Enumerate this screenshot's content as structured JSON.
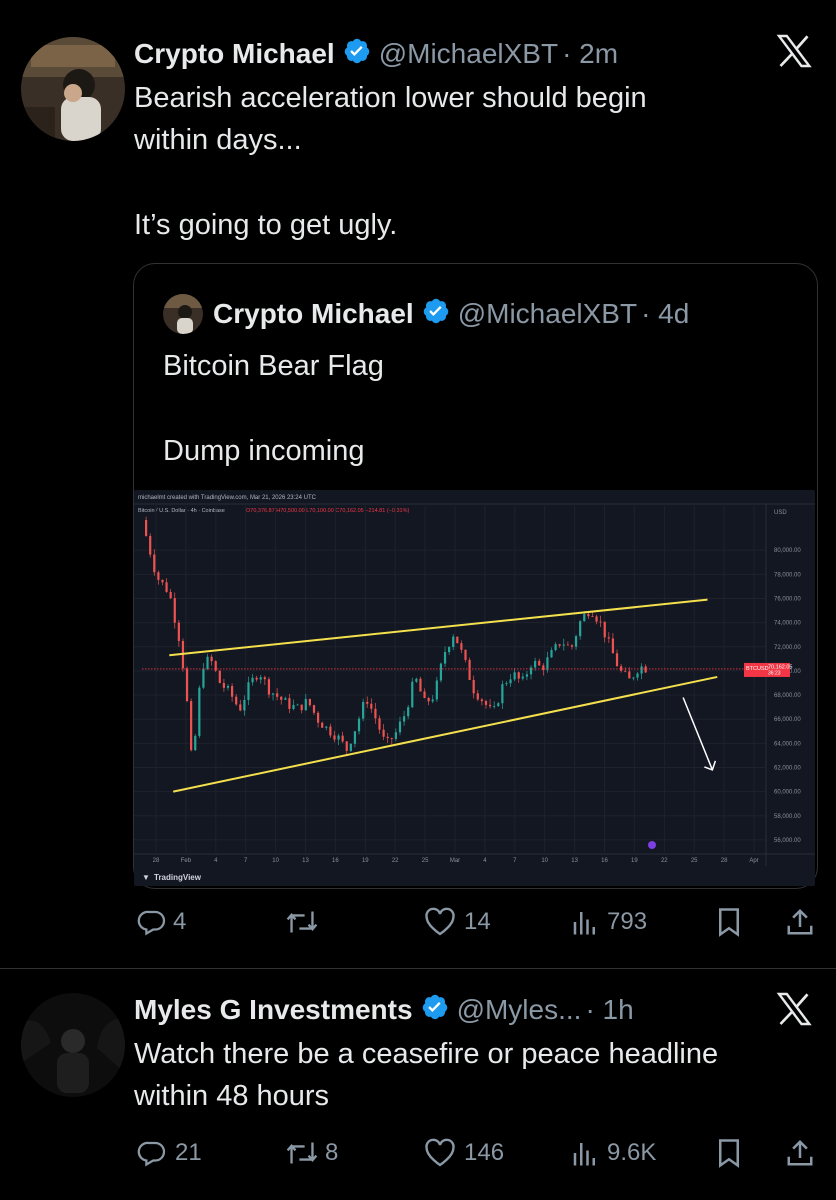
{
  "colors": {
    "background": "#000000",
    "text": "#e7e9ea",
    "muted": "#8b98a5",
    "verified": "#1d9bf0",
    "border": "#2f3336",
    "chart_bg": "#131722",
    "trendline": "#f4e04d",
    "price_line": "#f23645"
  },
  "tweets": [
    {
      "author": "Crypto Michael",
      "handle": "@MichaelXBT",
      "time": "· 2m",
      "text_line1": "Bearish acceleration lower should begin",
      "text_line2": "within days...",
      "text_line3": "It’s going to get ugly.",
      "quote": {
        "author": "Crypto Michael",
        "handle": "@MichaelXBT",
        "time": "· 4d",
        "text_line1": "Bitcoin Bear Flag",
        "text_line2": "Dump incoming",
        "chart": {
          "created_line": "michaelmt created with TradingView.com, Mar 21, 2026 23:24 UTC",
          "symbol_line": "Bitcoin / U.S. Dollar · 4h · Coinbase",
          "ohlc": "O70,376.87 H70,500.00 L70,100.00 C70,162.05 −214.81 (−0.31%)",
          "currency": "USD",
          "price_tag_symbol": "BTCUSD",
          "price_tag_value": "70,162.05",
          "price_tag_sub": "36:23",
          "watermark": "TradingView"
        }
      },
      "actions": {
        "replies": "4",
        "reposts": "",
        "likes": "14",
        "views": "793"
      }
    },
    {
      "author": "Myles G Investments",
      "handle": "@Myles...",
      "time": "· 1h",
      "text_line1": "Watch there be a ceasefire or peace headline",
      "text_line2": "within 48 hours",
      "actions": {
        "replies": "21",
        "reposts": "8",
        "likes": "146",
        "views": "9.6K"
      }
    }
  ],
  "icons": [
    "x-logo-icon",
    "verified-badge-icon",
    "reply-icon",
    "repost-icon",
    "like-icon",
    "views-icon",
    "bookmark-icon",
    "share-icon"
  ],
  "chart_data": {
    "type": "candlestick",
    "title": "Bitcoin / U.S. Dollar · 4h · Coinbase",
    "y_ticks": [
      "80,000.00",
      "78,000.00",
      "76,000.00",
      "74,000.00",
      "72,000.00",
      "70,000.00",
      "68,000.00",
      "66,000.00",
      "64,000.00",
      "62,000.00",
      "60,000.00",
      "58,000.00",
      "56,000.00"
    ],
    "x_ticks": [
      "28",
      "Feb",
      "4",
      "7",
      "10",
      "13",
      "16",
      "19",
      "22",
      "25",
      "Mar",
      "4",
      "7",
      "10",
      "13",
      "16",
      "19",
      "22",
      "25",
      "28",
      "Apr"
    ],
    "ylim": [
      55000,
      82500
    ],
    "last_price": 70162.05,
    "price_path": [
      [
        0,
        82500
      ],
      [
        1.5,
        77800
      ],
      [
        2.8,
        76500
      ],
      [
        4,
        72000
      ],
      [
        4.8,
        66000
      ],
      [
        5.2,
        61000
      ],
      [
        5.6,
        66500
      ],
      [
        6.2,
        70500
      ],
      [
        7,
        71000
      ],
      [
        8,
        69000
      ],
      [
        9,
        68200
      ],
      [
        10,
        66800
      ],
      [
        11,
        68800
      ],
      [
        12,
        70000
      ],
      [
        13,
        68500
      ],
      [
        14,
        67800
      ],
      [
        15,
        67200
      ],
      [
        16,
        66900
      ],
      [
        17,
        67500
      ],
      [
        18,
        66000
      ],
      [
        19,
        65200
      ],
      [
        20,
        64600
      ],
      [
        21,
        63500
      ],
      [
        22,
        65500
      ],
      [
        23,
        67800
      ],
      [
        24,
        66000
      ],
      [
        25,
        63800
      ],
      [
        26,
        64800
      ],
      [
        27,
        66500
      ],
      [
        28,
        69500
      ],
      [
        29,
        67300
      ],
      [
        30,
        68000
      ],
      [
        31,
        71500
      ],
      [
        32,
        73200
      ],
      [
        33,
        71000
      ],
      [
        34,
        68500
      ],
      [
        35,
        67500
      ],
      [
        36,
        66400
      ],
      [
        37,
        68800
      ],
      [
        38,
        69800
      ],
      [
        39,
        69000
      ],
      [
        40,
        70800
      ],
      [
        41,
        70200
      ],
      [
        42,
        71400
      ],
      [
        43,
        72500
      ],
      [
        44,
        71800
      ],
      [
        45,
        74200
      ],
      [
        46,
        75200
      ],
      [
        47,
        74000
      ],
      [
        48,
        72000
      ],
      [
        49,
        70000
      ],
      [
        50,
        69200
      ],
      [
        51,
        70400
      ],
      [
        52,
        70162
      ]
    ],
    "trendlines": [
      {
        "name": "upper",
        "from": [
          2.8,
          71300
        ],
        "to": [
          58,
          75900
        ]
      },
      {
        "name": "lower",
        "from": [
          3.2,
          60000
        ],
        "to": [
          59,
          69500
        ]
      }
    ],
    "x_range": [
      0,
      64
    ],
    "arrow": {
      "from": [
        55.5,
        67800
      ],
      "to": [
        58.5,
        61800
      ]
    }
  }
}
